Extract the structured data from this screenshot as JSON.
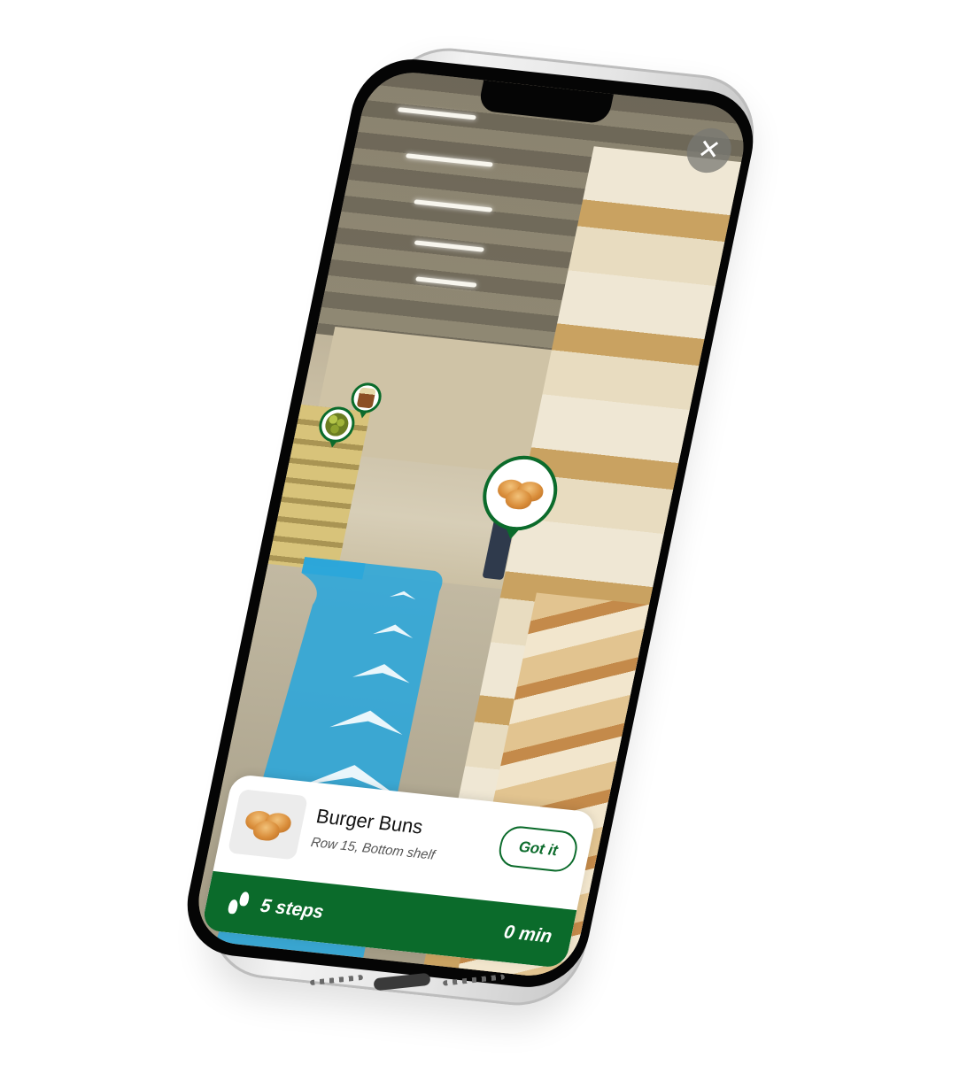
{
  "app": {
    "close_label": "✕"
  },
  "product": {
    "name": "Burger Buns",
    "location": "Row 15, Bottom shelf",
    "action_label": "Got it"
  },
  "navigation": {
    "steps_label": "5 steps",
    "eta_label": "0 min"
  },
  "icons": {
    "close": "close-icon",
    "steps": "footsteps-icon",
    "product_pin": "burger-bun-pin-icon",
    "other_pins": [
      "peas-pin-icon",
      "jar-pin-icon"
    ],
    "path": "ar-direction-arrows"
  },
  "colors": {
    "brand_green": "#0b6b2b",
    "ar_path_blue": "#2aa6db",
    "card_background": "#ffffff"
  }
}
